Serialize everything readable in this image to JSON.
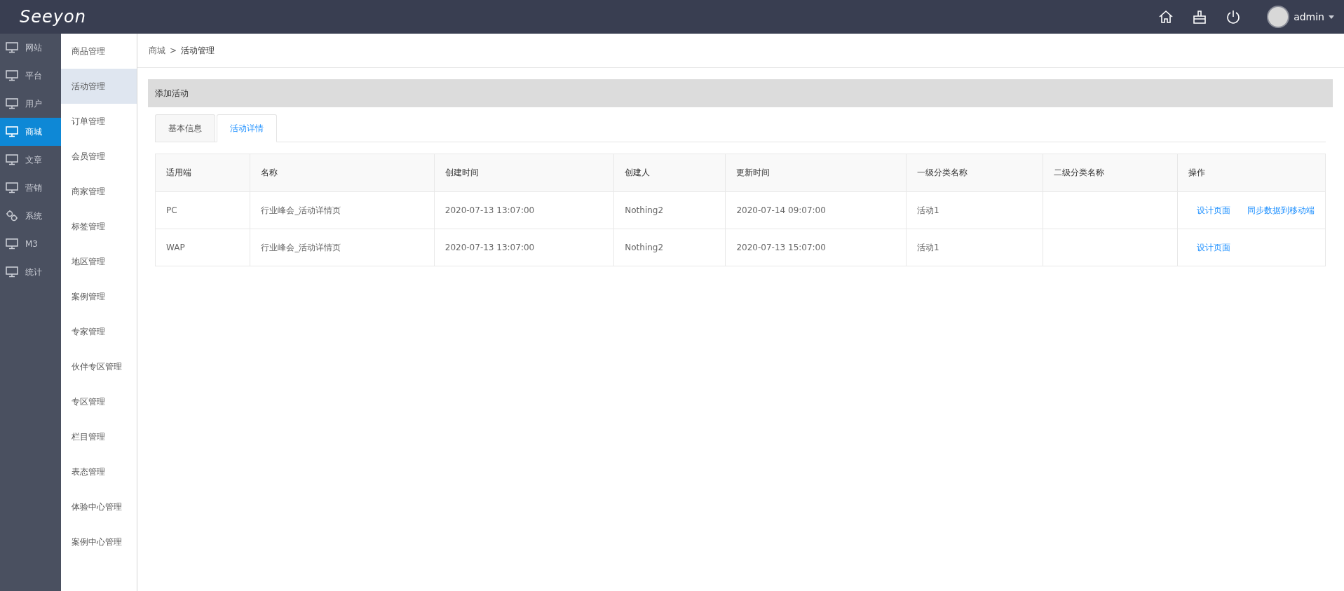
{
  "header": {
    "logo": "Seeyon",
    "user": "admin"
  },
  "main_nav": [
    {
      "label": "网站",
      "selected": false,
      "kind": "monitor"
    },
    {
      "label": "平台",
      "selected": false,
      "kind": "monitor"
    },
    {
      "label": "用户",
      "selected": false,
      "kind": "monitor"
    },
    {
      "label": "商城",
      "selected": true,
      "kind": "monitor"
    },
    {
      "label": "文章",
      "selected": false,
      "kind": "monitor"
    },
    {
      "label": "营销",
      "selected": false,
      "kind": "monitor"
    },
    {
      "label": "系统",
      "selected": false,
      "kind": "cogs"
    },
    {
      "label": "M3",
      "selected": false,
      "kind": "monitor"
    },
    {
      "label": "统计",
      "selected": false,
      "kind": "monitor"
    }
  ],
  "sub_nav": [
    {
      "label": "商品管理",
      "selected": false
    },
    {
      "label": "活动管理",
      "selected": true
    },
    {
      "label": "订单管理",
      "selected": false
    },
    {
      "label": "会员管理",
      "selected": false
    },
    {
      "label": "商家管理",
      "selected": false
    },
    {
      "label": "标签管理",
      "selected": false
    },
    {
      "label": "地区管理",
      "selected": false
    },
    {
      "label": "案例管理",
      "selected": false
    },
    {
      "label": "专家管理",
      "selected": false
    },
    {
      "label": "伙伴专区管理",
      "selected": false
    },
    {
      "label": "专区管理",
      "selected": false
    },
    {
      "label": "栏目管理",
      "selected": false
    },
    {
      "label": "表态管理",
      "selected": false
    },
    {
      "label": "体验中心管理",
      "selected": false
    },
    {
      "label": "案例中心管理",
      "selected": false
    }
  ],
  "breadcrumb": [
    "商城",
    ">",
    "活动管理"
  ],
  "panel_title": "添加活动",
  "tabs": [
    {
      "label": "基本信息",
      "selected": false
    },
    {
      "label": "活动详情",
      "selected": true
    }
  ],
  "table": {
    "columns": [
      "适用端",
      "名称",
      "创建时间",
      "创建人",
      "更新时间",
      "一级分类名称",
      "二级分类名称",
      "操作"
    ],
    "rows": [
      {
        "cells": [
          "PC",
          "行业峰会_活动详情页",
          "2020-07-13 13:07:00",
          "Nothing2",
          "2020-07-14 09:07:00",
          "活动1",
          ""
        ],
        "actions": [
          "设计页面",
          "同步数据到移动端"
        ]
      },
      {
        "cells": [
          "WAP",
          "行业峰会_活动详情页",
          "2020-07-13 13:07:00",
          "Nothing2",
          "2020-07-13 15:07:00",
          "活动1",
          ""
        ],
        "actions": [
          "设计页面"
        ]
      }
    ]
  }
}
